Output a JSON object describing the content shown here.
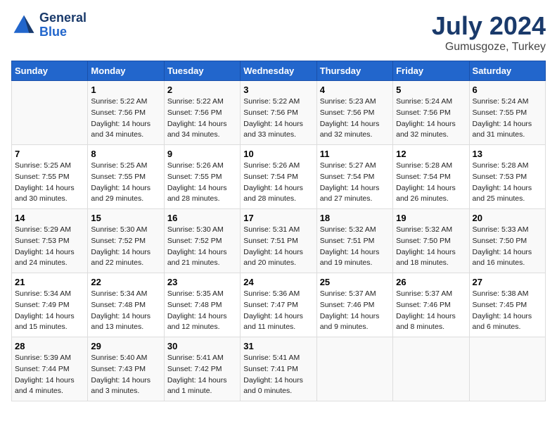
{
  "logo": {
    "line1": "General",
    "line2": "Blue"
  },
  "title": "July 2024",
  "subtitle": "Gumusgoze, Turkey",
  "days_header": [
    "Sunday",
    "Monday",
    "Tuesday",
    "Wednesday",
    "Thursday",
    "Friday",
    "Saturday"
  ],
  "weeks": [
    [
      {
        "day": "",
        "content": ""
      },
      {
        "day": "1",
        "content": "Sunrise: 5:22 AM\nSunset: 7:56 PM\nDaylight: 14 hours\nand 34 minutes."
      },
      {
        "day": "2",
        "content": "Sunrise: 5:22 AM\nSunset: 7:56 PM\nDaylight: 14 hours\nand 34 minutes."
      },
      {
        "day": "3",
        "content": "Sunrise: 5:22 AM\nSunset: 7:56 PM\nDaylight: 14 hours\nand 33 minutes."
      },
      {
        "day": "4",
        "content": "Sunrise: 5:23 AM\nSunset: 7:56 PM\nDaylight: 14 hours\nand 32 minutes."
      },
      {
        "day": "5",
        "content": "Sunrise: 5:24 AM\nSunset: 7:56 PM\nDaylight: 14 hours\nand 32 minutes."
      },
      {
        "day": "6",
        "content": "Sunrise: 5:24 AM\nSunset: 7:55 PM\nDaylight: 14 hours\nand 31 minutes."
      }
    ],
    [
      {
        "day": "7",
        "content": "Sunrise: 5:25 AM\nSunset: 7:55 PM\nDaylight: 14 hours\nand 30 minutes."
      },
      {
        "day": "8",
        "content": "Sunrise: 5:25 AM\nSunset: 7:55 PM\nDaylight: 14 hours\nand 29 minutes."
      },
      {
        "day": "9",
        "content": "Sunrise: 5:26 AM\nSunset: 7:55 PM\nDaylight: 14 hours\nand 28 minutes."
      },
      {
        "day": "10",
        "content": "Sunrise: 5:26 AM\nSunset: 7:54 PM\nDaylight: 14 hours\nand 28 minutes."
      },
      {
        "day": "11",
        "content": "Sunrise: 5:27 AM\nSunset: 7:54 PM\nDaylight: 14 hours\nand 27 minutes."
      },
      {
        "day": "12",
        "content": "Sunrise: 5:28 AM\nSunset: 7:54 PM\nDaylight: 14 hours\nand 26 minutes."
      },
      {
        "day": "13",
        "content": "Sunrise: 5:28 AM\nSunset: 7:53 PM\nDaylight: 14 hours\nand 25 minutes."
      }
    ],
    [
      {
        "day": "14",
        "content": "Sunrise: 5:29 AM\nSunset: 7:53 PM\nDaylight: 14 hours\nand 24 minutes."
      },
      {
        "day": "15",
        "content": "Sunrise: 5:30 AM\nSunset: 7:52 PM\nDaylight: 14 hours\nand 22 minutes."
      },
      {
        "day": "16",
        "content": "Sunrise: 5:30 AM\nSunset: 7:52 PM\nDaylight: 14 hours\nand 21 minutes."
      },
      {
        "day": "17",
        "content": "Sunrise: 5:31 AM\nSunset: 7:51 PM\nDaylight: 14 hours\nand 20 minutes."
      },
      {
        "day": "18",
        "content": "Sunrise: 5:32 AM\nSunset: 7:51 PM\nDaylight: 14 hours\nand 19 minutes."
      },
      {
        "day": "19",
        "content": "Sunrise: 5:32 AM\nSunset: 7:50 PM\nDaylight: 14 hours\nand 18 minutes."
      },
      {
        "day": "20",
        "content": "Sunrise: 5:33 AM\nSunset: 7:50 PM\nDaylight: 14 hours\nand 16 minutes."
      }
    ],
    [
      {
        "day": "21",
        "content": "Sunrise: 5:34 AM\nSunset: 7:49 PM\nDaylight: 14 hours\nand 15 minutes."
      },
      {
        "day": "22",
        "content": "Sunrise: 5:34 AM\nSunset: 7:48 PM\nDaylight: 14 hours\nand 13 minutes."
      },
      {
        "day": "23",
        "content": "Sunrise: 5:35 AM\nSunset: 7:48 PM\nDaylight: 14 hours\nand 12 minutes."
      },
      {
        "day": "24",
        "content": "Sunrise: 5:36 AM\nSunset: 7:47 PM\nDaylight: 14 hours\nand 11 minutes."
      },
      {
        "day": "25",
        "content": "Sunrise: 5:37 AM\nSunset: 7:46 PM\nDaylight: 14 hours\nand 9 minutes."
      },
      {
        "day": "26",
        "content": "Sunrise: 5:37 AM\nSunset: 7:46 PM\nDaylight: 14 hours\nand 8 minutes."
      },
      {
        "day": "27",
        "content": "Sunrise: 5:38 AM\nSunset: 7:45 PM\nDaylight: 14 hours\nand 6 minutes."
      }
    ],
    [
      {
        "day": "28",
        "content": "Sunrise: 5:39 AM\nSunset: 7:44 PM\nDaylight: 14 hours\nand 4 minutes."
      },
      {
        "day": "29",
        "content": "Sunrise: 5:40 AM\nSunset: 7:43 PM\nDaylight: 14 hours\nand 3 minutes."
      },
      {
        "day": "30",
        "content": "Sunrise: 5:41 AM\nSunset: 7:42 PM\nDaylight: 14 hours\nand 1 minute."
      },
      {
        "day": "31",
        "content": "Sunrise: 5:41 AM\nSunset: 7:41 PM\nDaylight: 14 hours\nand 0 minutes."
      },
      {
        "day": "",
        "content": ""
      },
      {
        "day": "",
        "content": ""
      },
      {
        "day": "",
        "content": ""
      }
    ]
  ]
}
